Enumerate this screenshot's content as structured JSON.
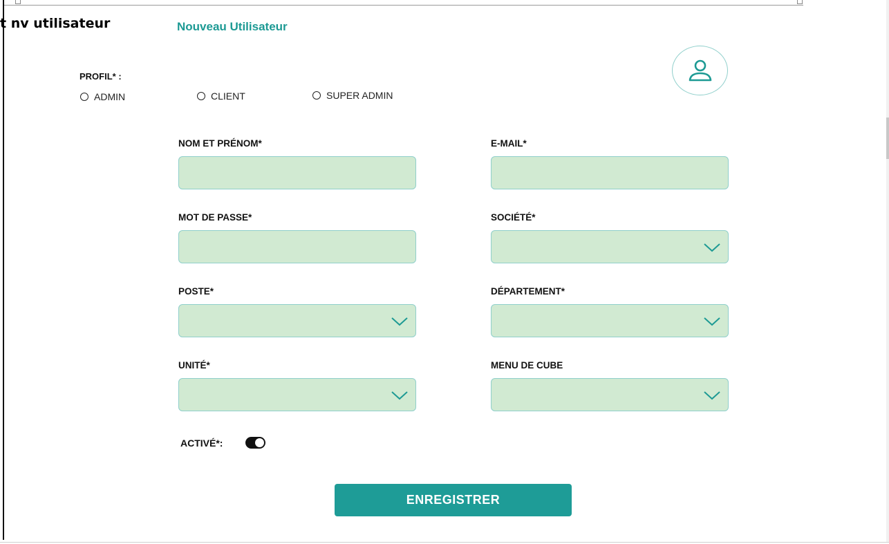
{
  "page_label": "t nv utilisateur",
  "form_title": "Nouveau Utilisateur",
  "avatar_icon": "user-icon",
  "profile": {
    "label": "PROFIL* :",
    "options": [
      "ADMIN",
      "CLIENT",
      "SUPER ADMIN"
    ]
  },
  "fields": {
    "name": {
      "label": "NOM ET PRÉNOM*",
      "value": ""
    },
    "email": {
      "label": "E-MAIL*",
      "value": ""
    },
    "password": {
      "label": "MOT DE PASSE*",
      "value": ""
    },
    "company": {
      "label": "SOCIÉTÉ*",
      "value": ""
    },
    "position": {
      "label": "POSTE*",
      "value": ""
    },
    "department": {
      "label": "DÉPARTEMENT*",
      "value": ""
    },
    "unit": {
      "label": "UNITÉ*",
      "value": ""
    },
    "cube_menu": {
      "label": "MENU DE CUBE",
      "value": ""
    }
  },
  "active": {
    "label": "ACTIVÉ*:",
    "enabled": true
  },
  "save_label": "ENREGISTRER",
  "colors": {
    "accent": "#1e9c97",
    "field_bg": "#d1ead2",
    "field_border": "#8fcfcb"
  }
}
